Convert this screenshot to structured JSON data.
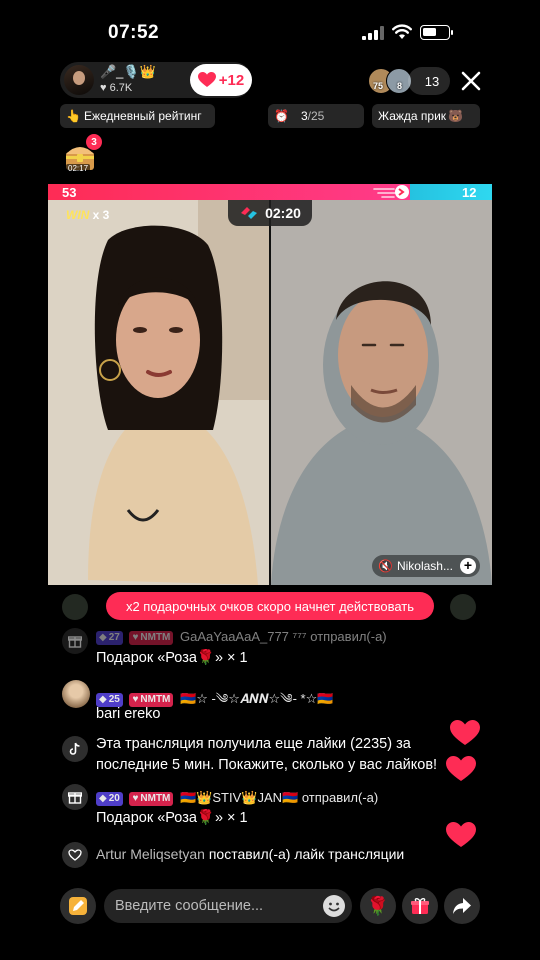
{
  "status": {
    "time": "07:52"
  },
  "host": {
    "name": "🎤_🎙️👑",
    "likes": "6.7K"
  },
  "like_button": {
    "label": "+12",
    "color": "#fe2c55"
  },
  "viewers": {
    "avatar1_level": "75",
    "avatar2_level": "8",
    "count": "13"
  },
  "chips": {
    "rating": "Ежедневный рейтинг",
    "progress_current": "3",
    "progress_total": "/25",
    "thirst": "Жажда прик"
  },
  "chest": {
    "badge": "3",
    "timer": "02:17"
  },
  "battle": {
    "score_left": "53",
    "score_right": "12",
    "timer": "02:20",
    "win_label": "WIN",
    "win_multiplier": "x 3",
    "left_fraction": 0.815,
    "opponent_name": "Nikolash...",
    "left_color": "#fe2c55",
    "right_color": "#25c2e0"
  },
  "banner": "x2 подарочных очков скоро начнет действовать",
  "chat": [
    {
      "level": "27",
      "fan": "NMTM",
      "user": "GaAaYaaAaA_777 ⁷⁷⁷",
      "action": "отправил(-а)",
      "body": "Подарок «Роза🌹» × 1"
    },
    {
      "level": "25",
      "fan": "NMTM",
      "user": "🇦🇲☆ -༄☆𝑨𝑵𝑵☆༄- *☆🇦🇲",
      "body": "bari ereko"
    },
    {
      "body": "Эта трансляция получила еще лайки (2235) за последние 5 мин. Покажите, сколько у вас лайков!"
    },
    {
      "level": "20",
      "fan": "NMTM",
      "user": "🇦🇲👑STIV👑JAN🇦🇲",
      "action": "отправил(-а)",
      "body": "Подарок «Роза🌹» × 1"
    },
    {
      "user": "Artur Meliqsetyan",
      "action": "поставил(-а) лайк трансляции"
    }
  ],
  "input": {
    "placeholder": "Введите сообщение..."
  },
  "icons": {
    "pen": "pen-icon",
    "emoji": "smile-icon",
    "rose": "rose-icon",
    "gift": "gift-icon",
    "share": "share-icon",
    "close": "close-icon",
    "heart": "heart-icon",
    "tiktok": "tiktok-icon",
    "like": "heart-outline-icon"
  }
}
